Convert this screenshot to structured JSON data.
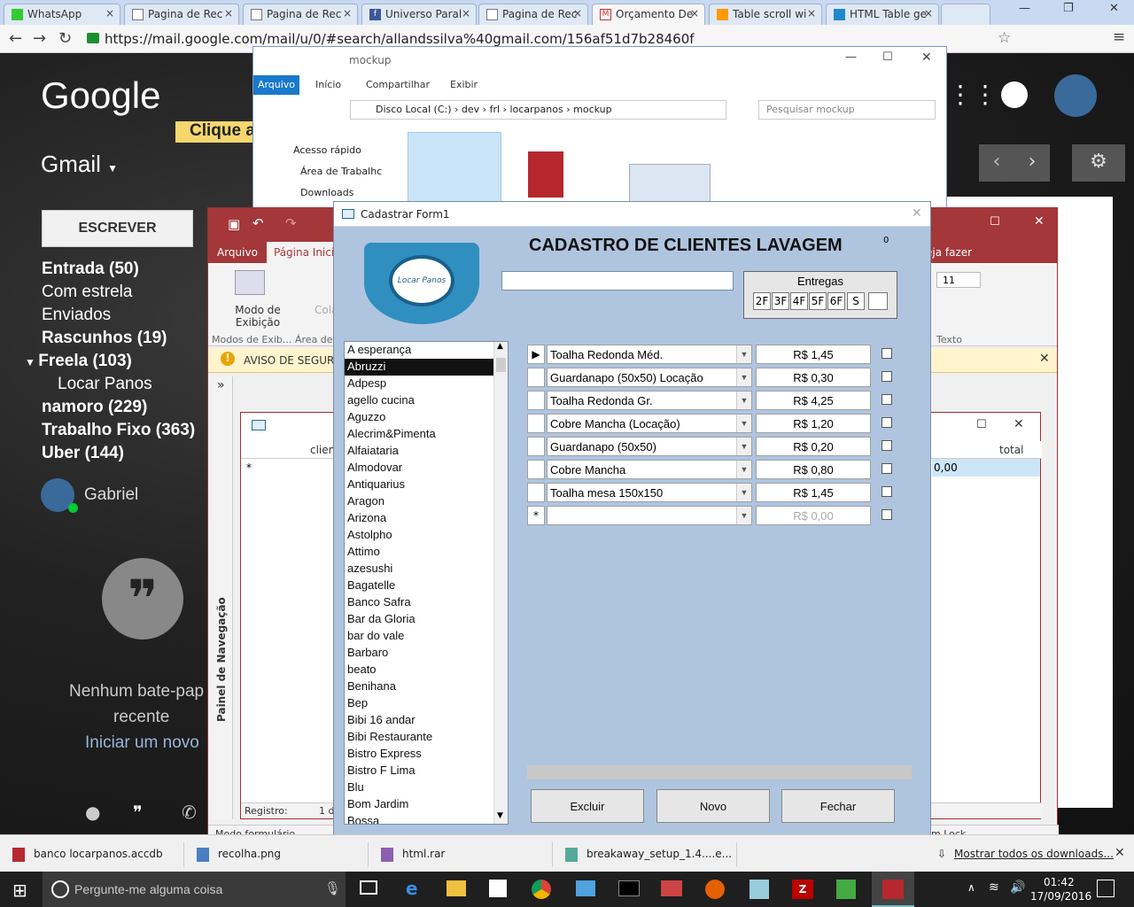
{
  "browser": {
    "tabs": [
      {
        "label": "WhatsApp"
      },
      {
        "label": "Pagina de Rec"
      },
      {
        "label": "Pagina de Rec"
      },
      {
        "label": "Universo Paral"
      },
      {
        "label": "Pagina de Rec"
      },
      {
        "label": "Orçamento De"
      },
      {
        "label": "Table scroll wi"
      },
      {
        "label": "HTML Table ge"
      }
    ],
    "url": "https://mail.google.com/mail/u/0/#search/allandssilva%40gmail.com/156af51d7b28460f"
  },
  "gmail": {
    "logo": "Google",
    "clique": "Clique a",
    "title": "Gmail",
    "compose": "ESCREVER",
    "nav": [
      {
        "label": "Entrada (50)",
        "bold": true
      },
      {
        "label": "Com estrela",
        "bold": false
      },
      {
        "label": "Enviados",
        "bold": false
      },
      {
        "label": "Rascunhos (19)",
        "bold": true
      },
      {
        "label": "Freela (103)",
        "bold": true
      },
      {
        "label": "Locar Panos",
        "bold": false
      },
      {
        "label": "namoro (229)",
        "bold": true
      },
      {
        "label": "Trabalho Fixo (363)",
        "bold": true
      },
      {
        "label": "Uber (144)",
        "bold": true
      }
    ],
    "user": "Gabriel",
    "chat_empty_1": "Nenhum bate-pap",
    "chat_empty_2": "recente",
    "chat_new": "Iniciar um novo"
  },
  "explorer": {
    "title": "mockup",
    "ribbon_tabs": [
      "Arquivo",
      "Início",
      "Compartilhar",
      "Exibir"
    ],
    "breadcrumb": [
      "Disco Local (C:)",
      "dev",
      "frl",
      "locarpanos",
      "mockup"
    ],
    "search_placeholder": "Pesquisar mockup",
    "quick": [
      "Acesso rápido",
      "Área de Trabalhc",
      "Downloads"
    ]
  },
  "access": {
    "tabs": [
      "Arquivo",
      "Página Inicia"
    ],
    "ribbon_view": "Modo de Exibição",
    "ribbon_cola": "Cola",
    "group1": "Modos de Exib...",
    "group2": "Área de",
    "font_size": "11",
    "text_group": "Texto",
    "tell_me": "eja fazer",
    "warning": "AVISO DE SEGURA",
    "nav_pane": "Painel de Navegação",
    "col_cliente": "clien",
    "col_total": "total",
    "total_value": "0,00",
    "record_label": "Registro:",
    "record_value": "1 d",
    "status_left": "Modo formulário",
    "status_right": "m Lock"
  },
  "form": {
    "window_title": "Cadastrar Form1",
    "heading": "CADASTRO DE CLIENTES LAVAGEM",
    "corner_mark": "0",
    "logo_text": "Locar Panos",
    "name_value": "",
    "entregas_label": "Entregas",
    "entregas": [
      "2F",
      "3F",
      "4F",
      "5F",
      "6F",
      "S",
      ""
    ],
    "clients": [
      "A esperança",
      "Abruzzi",
      "Adpesp",
      "agello cucina",
      "Aguzzo",
      "Alecrim&Pimenta",
      "Alfaiataria",
      "Almodovar",
      "Antiquarius",
      "Aragon",
      "Arizona",
      "Astolpho",
      "Attimo",
      "azesushi",
      "Bagatelle",
      "Banco Safra",
      "Bar da Gloria",
      "bar do vale",
      "Barbaro",
      "beato",
      "Benihana",
      "Bep",
      "Bibi 16 andar",
      "Bibi Restaurante",
      "Bistro Express",
      "Bistro F Lima",
      "Blu",
      "Bom Jardim",
      "Bossa"
    ],
    "selected_client": "Abruzzi",
    "items": [
      {
        "product": "Toalha Redonda Méd.",
        "price": "R$ 1,45"
      },
      {
        "product": "Guardanapo (50x50) Locação",
        "price": "R$ 0,30"
      },
      {
        "product": "Toalha Redonda Gr.",
        "price": "R$ 4,25"
      },
      {
        "product": "Cobre Mancha (Locação)",
        "price": "R$ 1,20"
      },
      {
        "product": "Guardanapo (50x50)",
        "price": "R$ 0,20"
      },
      {
        "product": "Cobre Mancha",
        "price": "R$ 0,80"
      },
      {
        "product": "Toalha mesa 150x150",
        "price": "R$ 1,45"
      },
      {
        "product": "",
        "price": "R$ 0,00"
      }
    ],
    "buttons": {
      "delete": "Excluir",
      "new": "Novo",
      "close": "Fechar"
    }
  },
  "downloads": {
    "items": [
      "banco locarpanos.accdb",
      "recolha.png",
      "html.rar",
      "breakaway_setup_1.4....e..."
    ],
    "show_all": "Mostrar todos os downloads..."
  },
  "taskbar": {
    "search_placeholder": "Pergunte-me alguma coisa",
    "time": "01:42",
    "date": "17/09/2016"
  }
}
